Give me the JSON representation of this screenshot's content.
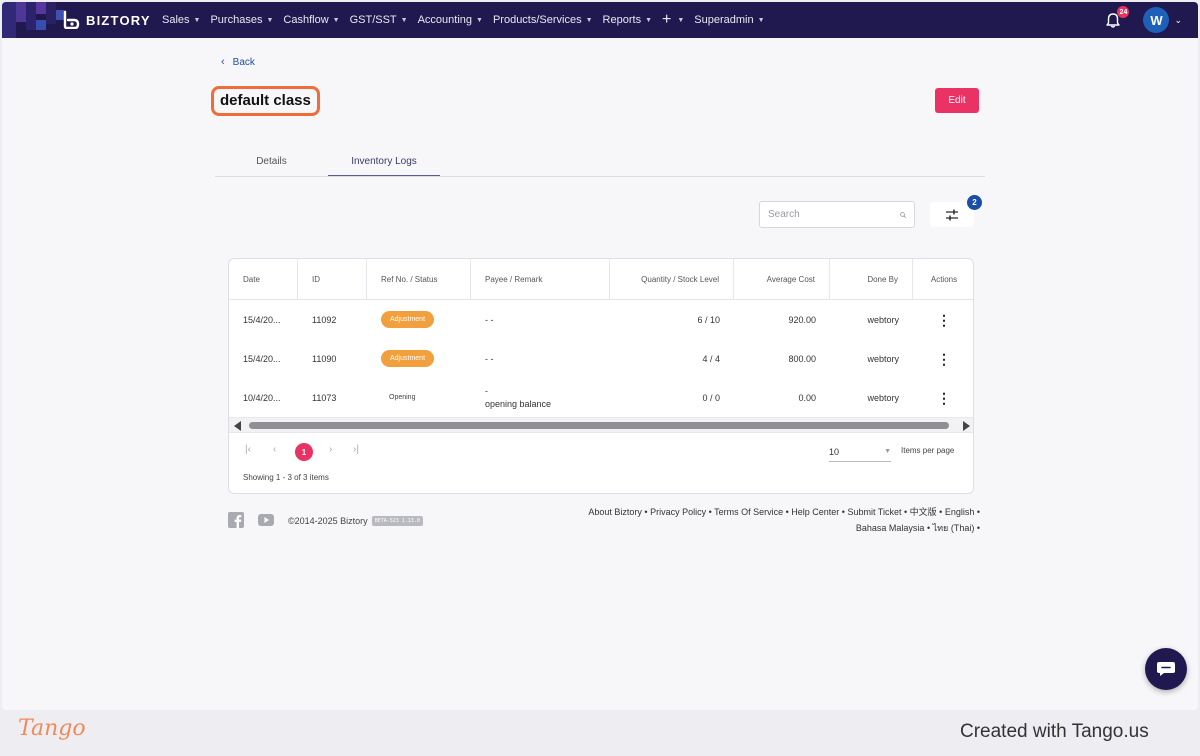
{
  "colors": {
    "navbar": "#20194f",
    "accent": "#ea3264",
    "badge_orange": "#f2a03d",
    "highlight": "#f26b3a",
    "link": "#1f4fa3"
  },
  "brand": {
    "name": "BIZTORY",
    "logo_icon": "biztory-logo-icon"
  },
  "nav": {
    "items": [
      {
        "label": "Sales"
      },
      {
        "label": "Purchases"
      },
      {
        "label": "Cashflow"
      },
      {
        "label": "GST/SST"
      },
      {
        "label": "Accounting"
      },
      {
        "label": "Products/Services"
      },
      {
        "label": "Reports"
      }
    ],
    "plus_label": "+",
    "superadmin_label": "Superadmin",
    "notification_count": "24",
    "avatar_initial": "W"
  },
  "page": {
    "back_label": "Back",
    "title": "default class",
    "edit_label": "Edit"
  },
  "tabs": [
    {
      "label": "Details",
      "active": false
    },
    {
      "label": "Inventory Logs",
      "active": true
    }
  ],
  "search": {
    "placeholder": "Search",
    "value": ""
  },
  "filter": {
    "count": "2"
  },
  "table": {
    "columns": [
      "Date",
      "ID",
      "Ref No. / Status",
      "Payee / Remark",
      "Quantity / Stock Level",
      "Average Cost",
      "Done By",
      "Actions"
    ],
    "rows": [
      {
        "date": "15/4/20...",
        "id": "11092",
        "status": "Adjustment",
        "status_type": "badge",
        "payee": "- -",
        "remark": "",
        "qty": "6 / 10",
        "avg_cost": "920.00",
        "done_by": "webtory",
        "actions_icon": "kebab-menu-icon"
      },
      {
        "date": "15/4/20...",
        "id": "11090",
        "status": "Adjustment",
        "status_type": "badge",
        "payee": "- -",
        "remark": "",
        "qty": "4 / 4",
        "avg_cost": "800.00",
        "done_by": "webtory",
        "actions_icon": "kebab-menu-icon"
      },
      {
        "date": "10/4/20...",
        "id": "11073",
        "status": "Opening",
        "status_type": "plain",
        "payee": "-",
        "remark": "opening balance",
        "qty": "0 / 0",
        "avg_cost": "0.00",
        "done_by": "webtory",
        "actions_icon": "kebab-menu-icon"
      }
    ]
  },
  "pagination": {
    "current_page": "1",
    "per_page": "10",
    "per_page_label": "Items per page",
    "showing": "Showing 1 - 3 of 3 items"
  },
  "footer": {
    "copyright": "©2014-2025 Biztory",
    "version": "BETA-523 1.13.0",
    "links": [
      "About Biztory",
      "Privacy Policy",
      "Terms Of Service",
      "Help Center",
      "Submit Ticket",
      "中文版",
      "English",
      "Bahasa Malaysia",
      "ไทย (Thai)"
    ],
    "separator": " • "
  },
  "tango": {
    "logo": "Tango",
    "credit": "Created with Tango.us"
  }
}
